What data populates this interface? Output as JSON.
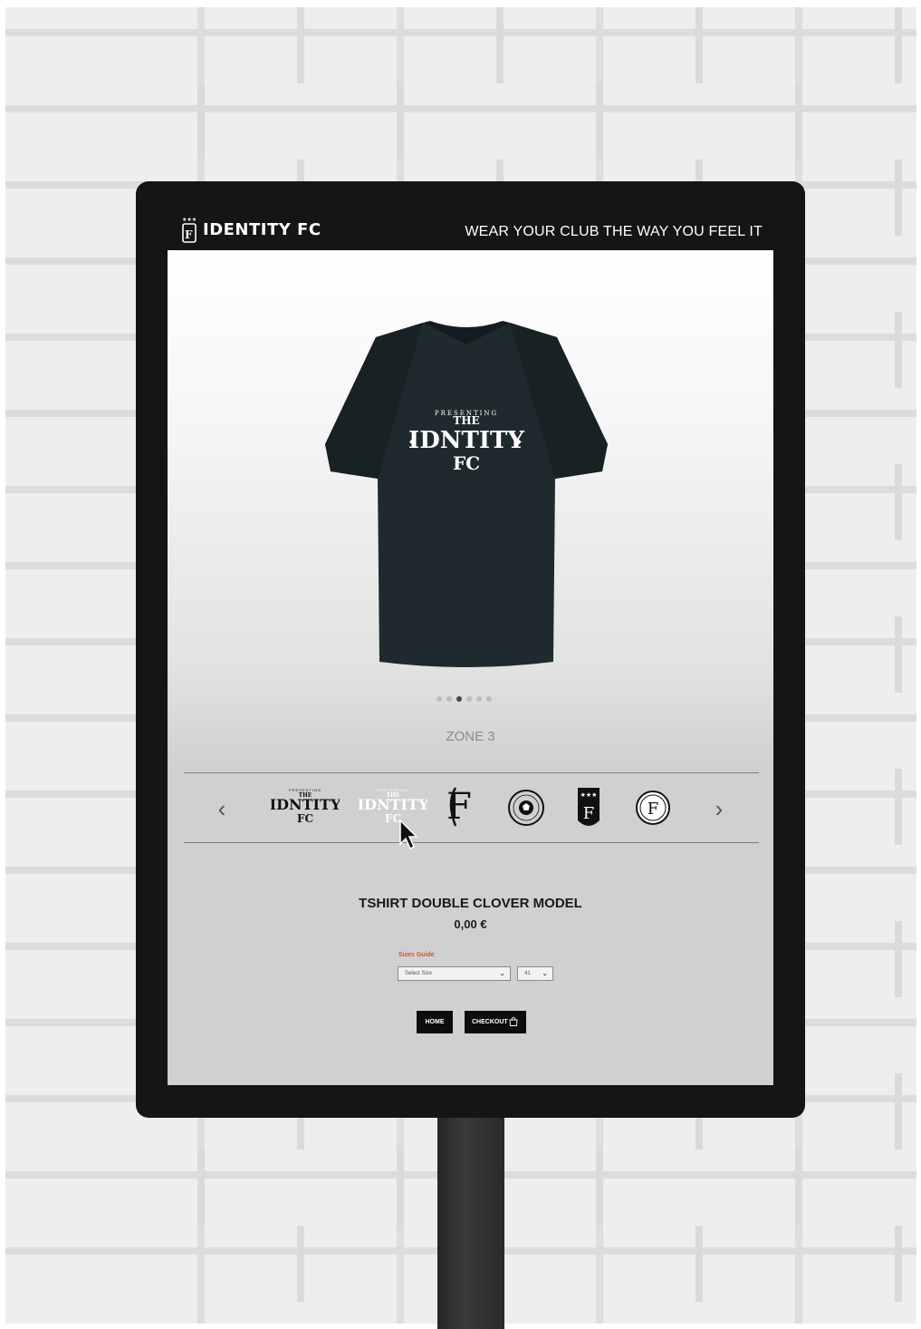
{
  "header": {
    "brand": "IDENTITY FC",
    "tagline": "WEAR YOUR CLUB THE WAY YOU FEEL IT"
  },
  "gallery": {
    "slide_count": 6,
    "active_slide": 3,
    "zone_label": "ZONE 3",
    "shirt_color": "#1f2a2e"
  },
  "designs": {
    "items": [
      {
        "name": "presenting-the-identity-fc",
        "variant": "black"
      },
      {
        "name": "presenting-the-identity-fc",
        "variant": "white"
      },
      {
        "name": "ifc-monogram",
        "variant": "black"
      },
      {
        "name": "round-football-badge",
        "variant": "black"
      },
      {
        "name": "shield-ifc-three-stars",
        "variant": "black"
      },
      {
        "name": "circle-ifc-monogram",
        "variant": "black"
      }
    ],
    "selected_index": 1
  },
  "product": {
    "name": "TSHIRT DOUBLE CLOVER MODEL",
    "price": "0,00 €"
  },
  "sizes": {
    "guide_label": "Sizes Guide",
    "size_placeholder": "Select Size",
    "number_value": "41"
  },
  "actions": {
    "home_label": "HOME",
    "checkout_label": "CHECKOUT"
  },
  "colors": {
    "kiosk": "#151515",
    "accent": "#d9502f",
    "button": "#0d0d0d"
  }
}
